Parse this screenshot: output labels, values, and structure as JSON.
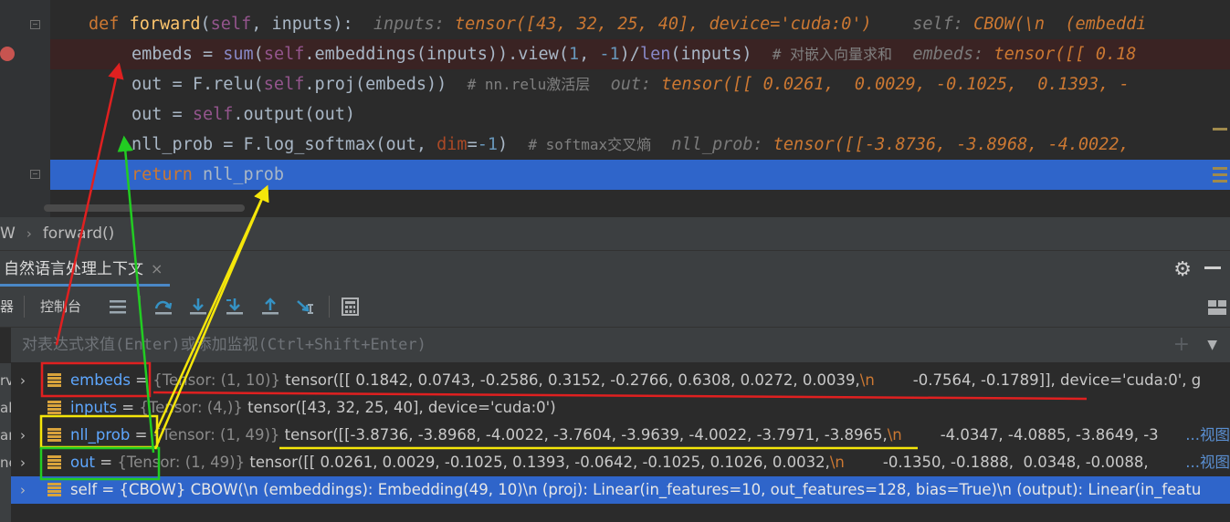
{
  "editor": {
    "line1": {
      "kw": "def",
      "fn": "forward",
      "open": "(",
      "self": "self",
      "rest": ", inputs):",
      "hint_label": "inputs:",
      "hint_value": "tensor([43, 32, 25, 40], device='cuda:0')",
      "hint2_label": "self:",
      "hint2_value": "CBOW(\\n  (embeddi"
    },
    "line2": {
      "a": "embeds = ",
      "sum": "sum",
      "b": "(",
      "self": "self",
      "c": ".embeddings(inputs)).view(",
      "n1": "1",
      "d": ", ",
      "n2": "-1",
      "e": ")/",
      "len": "len",
      "f": "(inputs)",
      "comment": "# 对嵌入向量求和",
      "hint_label": "embeds:",
      "hint_value": "tensor([[ 0.18"
    },
    "line3": {
      "a": "out = F.relu(",
      "self": "self",
      "b": ".proj(embeds))",
      "comment": "# nn.relu激活层",
      "hint_label": "out:",
      "hint_value": "tensor([[ 0.0261,  0.0029, -0.1025,  0.1393, -"
    },
    "line4": {
      "a": "out = ",
      "self": "self",
      "b": ".output(out)"
    },
    "line5": {
      "a": "nll_prob = F.log_softmax(out, ",
      "param": "dim",
      "b": "=",
      "n": "-1",
      "c": ")",
      "comment": "# softmax交叉熵",
      "hint_label": "nll_prob:",
      "hint_value": "tensor([[-3.8736, -3.8968, -4.0022,"
    },
    "line6": {
      "kw": "return",
      "rest": " nll_prob"
    }
  },
  "breadcrumb": {
    "class_name": "W",
    "method": "forward()"
  },
  "panel": {
    "tab_label": "自然语言处理上下文",
    "tab_close": "×"
  },
  "toolbar": {
    "cut_label": "器",
    "console_label": "控制台"
  },
  "evaluate": {
    "placeholder": "对表达式求值(Enter)或添加监视(Ctrl+Shift+Enter)"
  },
  "left_strip": [
    "rv",
    "al",
    "ar",
    "ne"
  ],
  "variables": [
    {
      "name": "embeds",
      "type": "{Tensor: (1, 10)}",
      "value": "tensor([[ 0.1842,  0.0743, -0.2586,  0.3152, -0.2766,  0.6308,  0.0272,  0.0039,",
      "esc": "\\n",
      "tail": "        -0.7564, -0.1789]], device='cuda:0', g",
      "view": ""
    },
    {
      "name": "inputs",
      "type": "{Tensor: (4,)}",
      "value": "tensor([43, 32, 25, 40], device='cuda:0')",
      "esc": "",
      "tail": "",
      "view": ""
    },
    {
      "name": "nll_prob",
      "type": "{Tensor: (1, 49)}",
      "value": "tensor([[-3.8736, -3.8968, -4.0022, -3.7604, -3.9639, -4.0022, -3.7971, -3.8965,",
      "esc": "\\n",
      "tail": "        -4.0347, -4.0885, -3.8649, -3",
      "view": "...视图"
    },
    {
      "name": "out",
      "type": "{Tensor: (1, 49)}",
      "value": "tensor([[ 0.0261,  0.0029, -0.1025,  0.1393, -0.0642, -0.1025,  0.1026,  0.0032,",
      "esc": "\\n",
      "tail": "        -0.1350, -0.1888,  0.0348, -0.0088,",
      "view": "...视图"
    },
    {
      "name": "self",
      "type": "",
      "value": "{CBOW} CBOW(\\n  (embeddings): Embedding(49, 10)\\n  (proj): Linear(in_features=10, out_features=128, bias=True)\\n  (output): Linear(in_featu",
      "esc": "",
      "tail": "",
      "view": ""
    }
  ],
  "colors": {
    "annotation_red": "#e02020",
    "annotation_green": "#22cc22",
    "annotation_yellow": "#f5e60a",
    "accent": "#2f65ca"
  }
}
